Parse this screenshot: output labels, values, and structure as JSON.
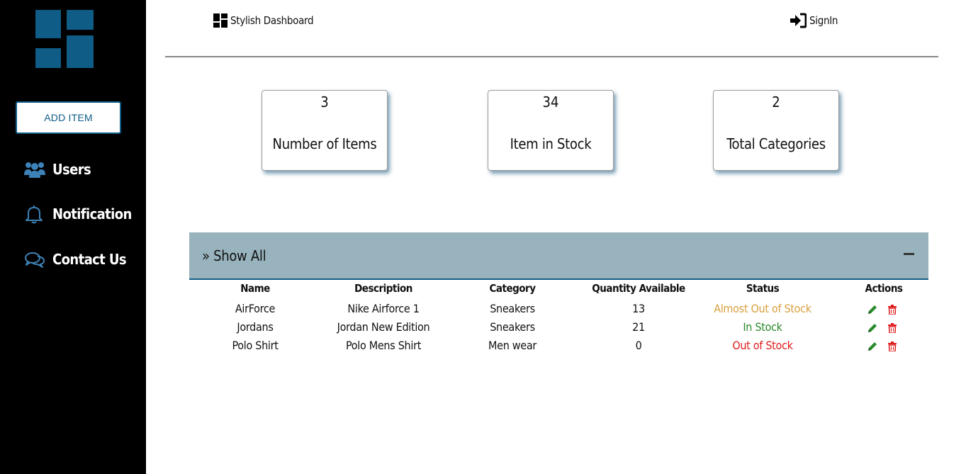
{
  "sidebar": {
    "add_item_label": "ADD ITEM",
    "items": [
      {
        "label": "Users",
        "icon": "users-icon"
      },
      {
        "label": "Notification",
        "icon": "bell-icon"
      },
      {
        "label": "Contact Us",
        "icon": "chat-icon"
      }
    ]
  },
  "header": {
    "brand": "Stylish Dashboard",
    "signin": "SignIn"
  },
  "cards": [
    {
      "value": "3",
      "label": "Number of Items"
    },
    {
      "value": "34",
      "label": "Item in Stock"
    },
    {
      "value": "2",
      "label": "Total Categories"
    }
  ],
  "panel": {
    "title": "» Show All"
  },
  "table": {
    "columns": [
      "Name",
      "Description",
      "Category",
      "Quantity Available",
      "Status",
      "Actions"
    ],
    "rows": [
      {
        "name": "AirForce",
        "description": "Nike Airforce 1",
        "category": "Sneakers",
        "quantity": "13",
        "status": "Almost Out of Stock",
        "status_color": "#d9a03f"
      },
      {
        "name": "Jordans",
        "description": "Jordan New Edition",
        "category": "Sneakers",
        "quantity": "21",
        "status": "In Stock",
        "status_color": "#2a8a2a"
      },
      {
        "name": "Polo Shirt",
        "description": "Polo Mens Shirt",
        "category": "Men wear",
        "quantity": "0",
        "status": "Out of Stock",
        "status_color": "#e01b1b"
      }
    ]
  },
  "colors": {
    "sidebar_bg": "#000000",
    "accent": "#0f5c86",
    "panel_header": "#98b3bd",
    "edit_icon": "#2a8a2a",
    "delete_icon": "#e01b1b"
  }
}
